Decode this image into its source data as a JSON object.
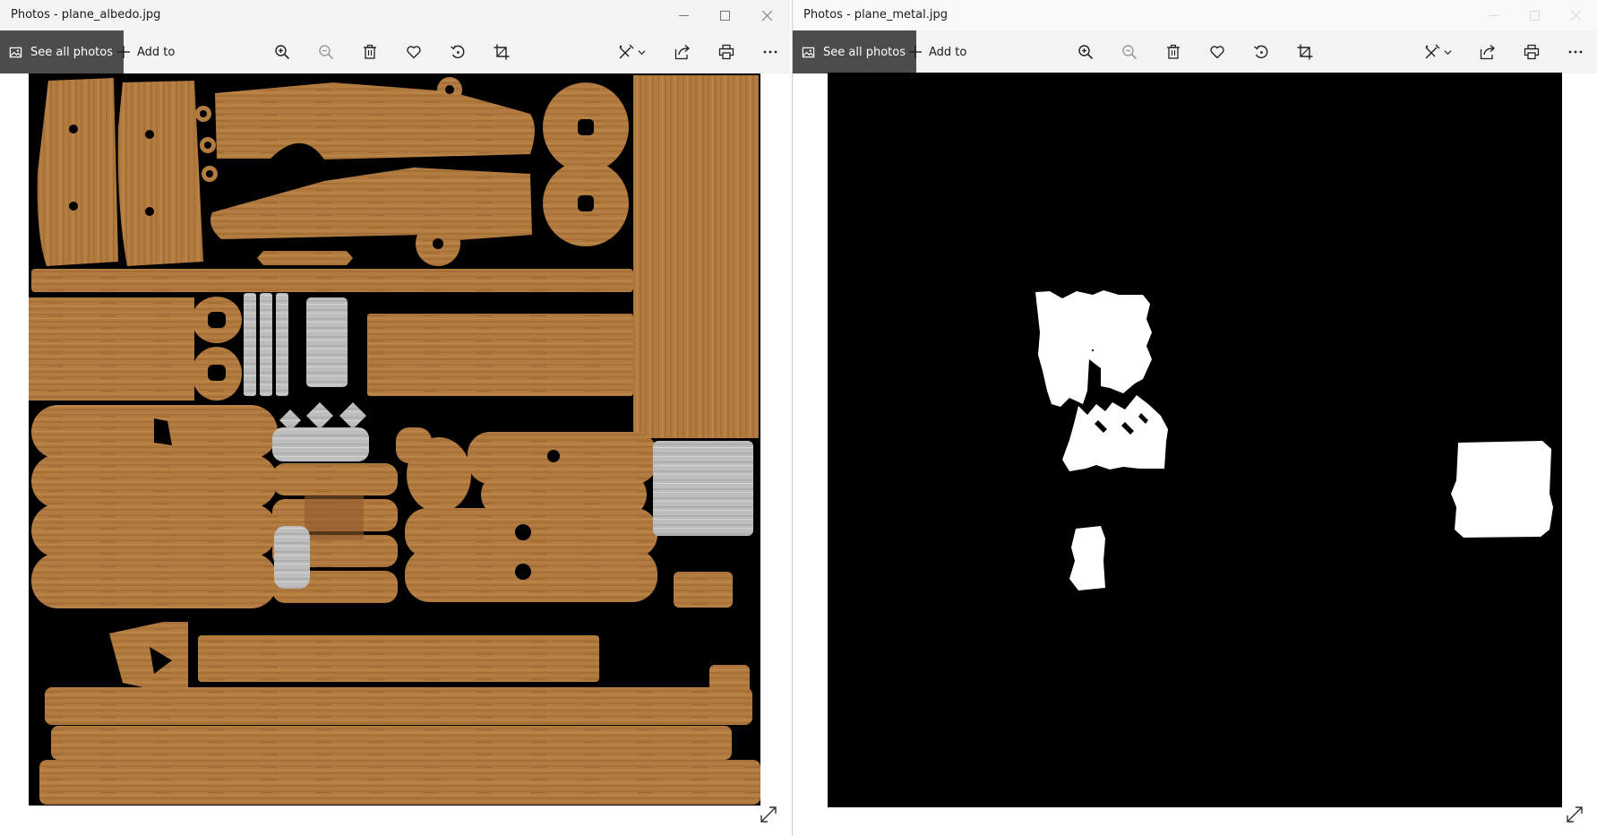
{
  "left_window": {
    "title": "Photos - plane_albedo.jpg",
    "see_all_label": "See all photos",
    "add_to_label": "Add to"
  },
  "right_window": {
    "title": "Photos - plane_metal.jpg",
    "see_all_label": "See all photos",
    "add_to_label": "Add to"
  },
  "toolbar_icons": [
    "zoom-in-icon",
    "zoom-out-icon",
    "delete-icon",
    "heart-icon",
    "rotate-icon",
    "crop-icon",
    "edit-icon",
    "share-icon",
    "print-icon",
    "more-icon"
  ],
  "colors": {
    "toolbar_bg": "#f3f3f3",
    "see_all_bg": "#4c4c4c",
    "wood": "#b07a40",
    "metal": "#bdbdbd",
    "mask_white": "#ffffff",
    "canvas_bg": "#000000"
  }
}
